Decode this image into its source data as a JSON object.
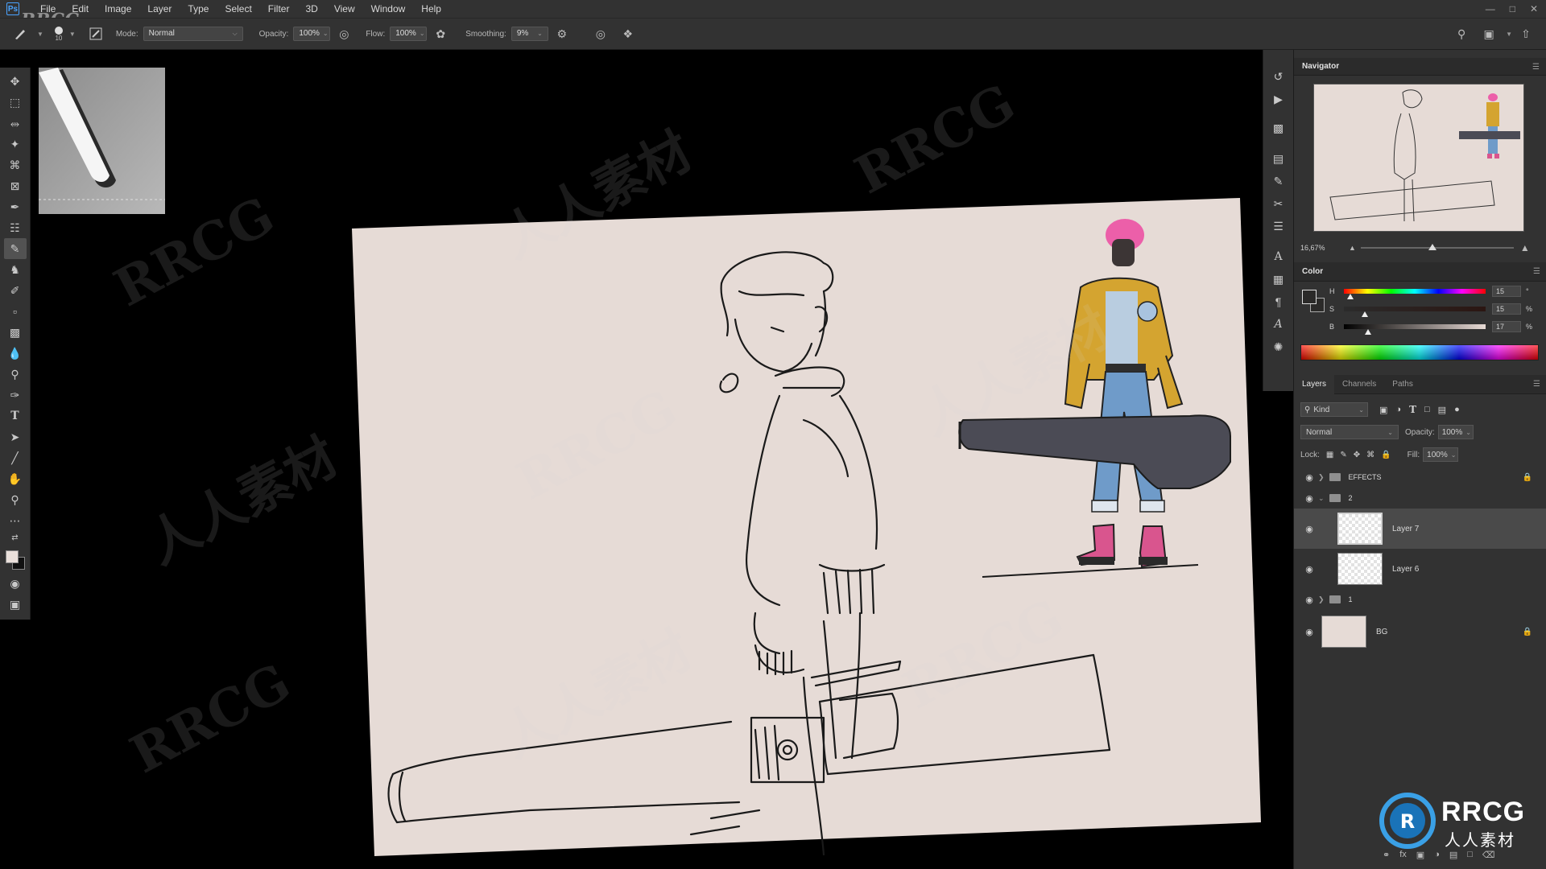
{
  "menu": {
    "logo": "Ps",
    "items": [
      "File",
      "Edit",
      "Image",
      "Layer",
      "Type",
      "Select",
      "Filter",
      "3D",
      "View",
      "Window",
      "Help"
    ]
  },
  "watermark_top": "RRCG",
  "options": {
    "brush_size": "10",
    "mode_label": "Mode:",
    "mode_value": "Normal",
    "opacity_label": "Opacity:",
    "opacity_value": "100%",
    "flow_label": "Flow:",
    "flow_value": "100%",
    "smoothing_label": "Smoothing:",
    "smoothing_value": "9%"
  },
  "navigator": {
    "title": "Navigator",
    "zoom": "16,67%"
  },
  "color": {
    "title": "Color",
    "h_label": "H",
    "h_value": "15",
    "h_unit": "°",
    "s_label": "S",
    "s_value": "15",
    "s_unit": "%",
    "b_label": "B",
    "b_value": "17",
    "b_unit": "%",
    "foreground": "#2b2a29",
    "background": "#eae0db"
  },
  "layers_panel": {
    "tabs": [
      "Layers",
      "Channels",
      "Paths"
    ],
    "kind_label": "Kind",
    "blend_mode": "Normal",
    "opacity_label": "Opacity:",
    "opacity_value": "100%",
    "lock_label": "Lock:",
    "fill_label": "Fill:",
    "fill_value": "100%",
    "layers": [
      {
        "name": "EFFECTS",
        "type": "group",
        "collapsed": true,
        "locked": true
      },
      {
        "name": "2",
        "type": "group",
        "collapsed": false,
        "locked": false
      },
      {
        "name": "Layer 7",
        "type": "layer",
        "selected": true
      },
      {
        "name": "Layer 6",
        "type": "layer",
        "selected": false
      },
      {
        "name": "1",
        "type": "group",
        "collapsed": true,
        "locked": false
      },
      {
        "name": "BG",
        "type": "layer",
        "locked": true
      }
    ]
  },
  "brand": {
    "name": "RRCG",
    "subtitle": "人人素材"
  },
  "watermarks": [
    "RRCG",
    "人人素材"
  ]
}
